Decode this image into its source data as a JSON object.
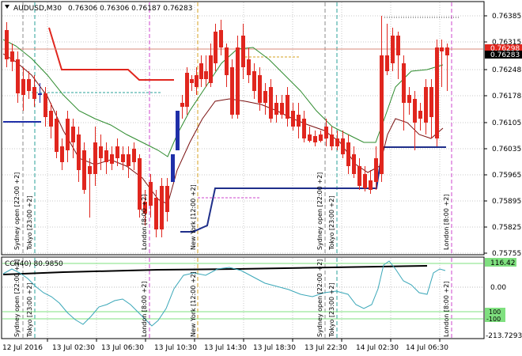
{
  "header": {
    "symbol": "AUDUSD,M30",
    "ohlc": "0.76306 0.76306 0.76187 0.76283"
  },
  "indicator": {
    "label": "CCI(40) 80.9850"
  },
  "price_tags": {
    "ask": "0.76298",
    "bid": "0.76283"
  },
  "osc_tags": {
    "top": "116.42",
    "p100": "100",
    "m100": "-100"
  },
  "price_axis": [
    "0.76385",
    "0.76315",
    "0.76248",
    "0.76178",
    "0.76105",
    "0.76035",
    "0.75965",
    "0.75895",
    "0.75825",
    "0.75755"
  ],
  "osc_axis": [
    "116.42",
    "0.00",
    "-213.7293"
  ],
  "time_axis": [
    "12 Jul 2016",
    "13 Jul 02:30",
    "13 Jul 06:30",
    "13 Jul 10:30",
    "13 Jul 14:30",
    "13 Jul 18:30",
    "13 Jul 22:30",
    "14 Jul 02:30",
    "14 Jul 06:30"
  ],
  "sessions": {
    "top": [
      {
        "text": "Sydney open  [22:00 +2]"
      },
      {
        "text": "Tokyo  [23:00 +2]"
      },
      {
        "text": "London  [8:00 +2]"
      },
      {
        "text": "New York  [12:00 +2]"
      },
      {
        "text": "Sydney open  [22:00 +2]"
      },
      {
        "text": "Tokyo  [23:00 +2]"
      },
      {
        "text": "London  [8:00 +2]"
      }
    ],
    "bottom": [
      {
        "text": "Sydney open  [22:00 +2]"
      },
      {
        "text": "Tokyo  [23:00 +2]"
      },
      {
        "text": "London  [8:00 +2]"
      },
      {
        "text": "New York  [12:00 +2]"
      },
      {
        "text": "Sydney open  [22:00 +2]"
      },
      {
        "text": "Tokyo  [23:00 +2]"
      },
      {
        "text": "London  [8:00 +2]"
      }
    ]
  },
  "colors": {
    "bull": "#1f2fa8",
    "bear": "#e0261e",
    "ma_fast": "#7a1010",
    "ma_slow": "#2e8b2e",
    "cci": "#3aa7b8",
    "level_line": "#d88a7a",
    "accent_green": "#7fe07f"
  }
}
